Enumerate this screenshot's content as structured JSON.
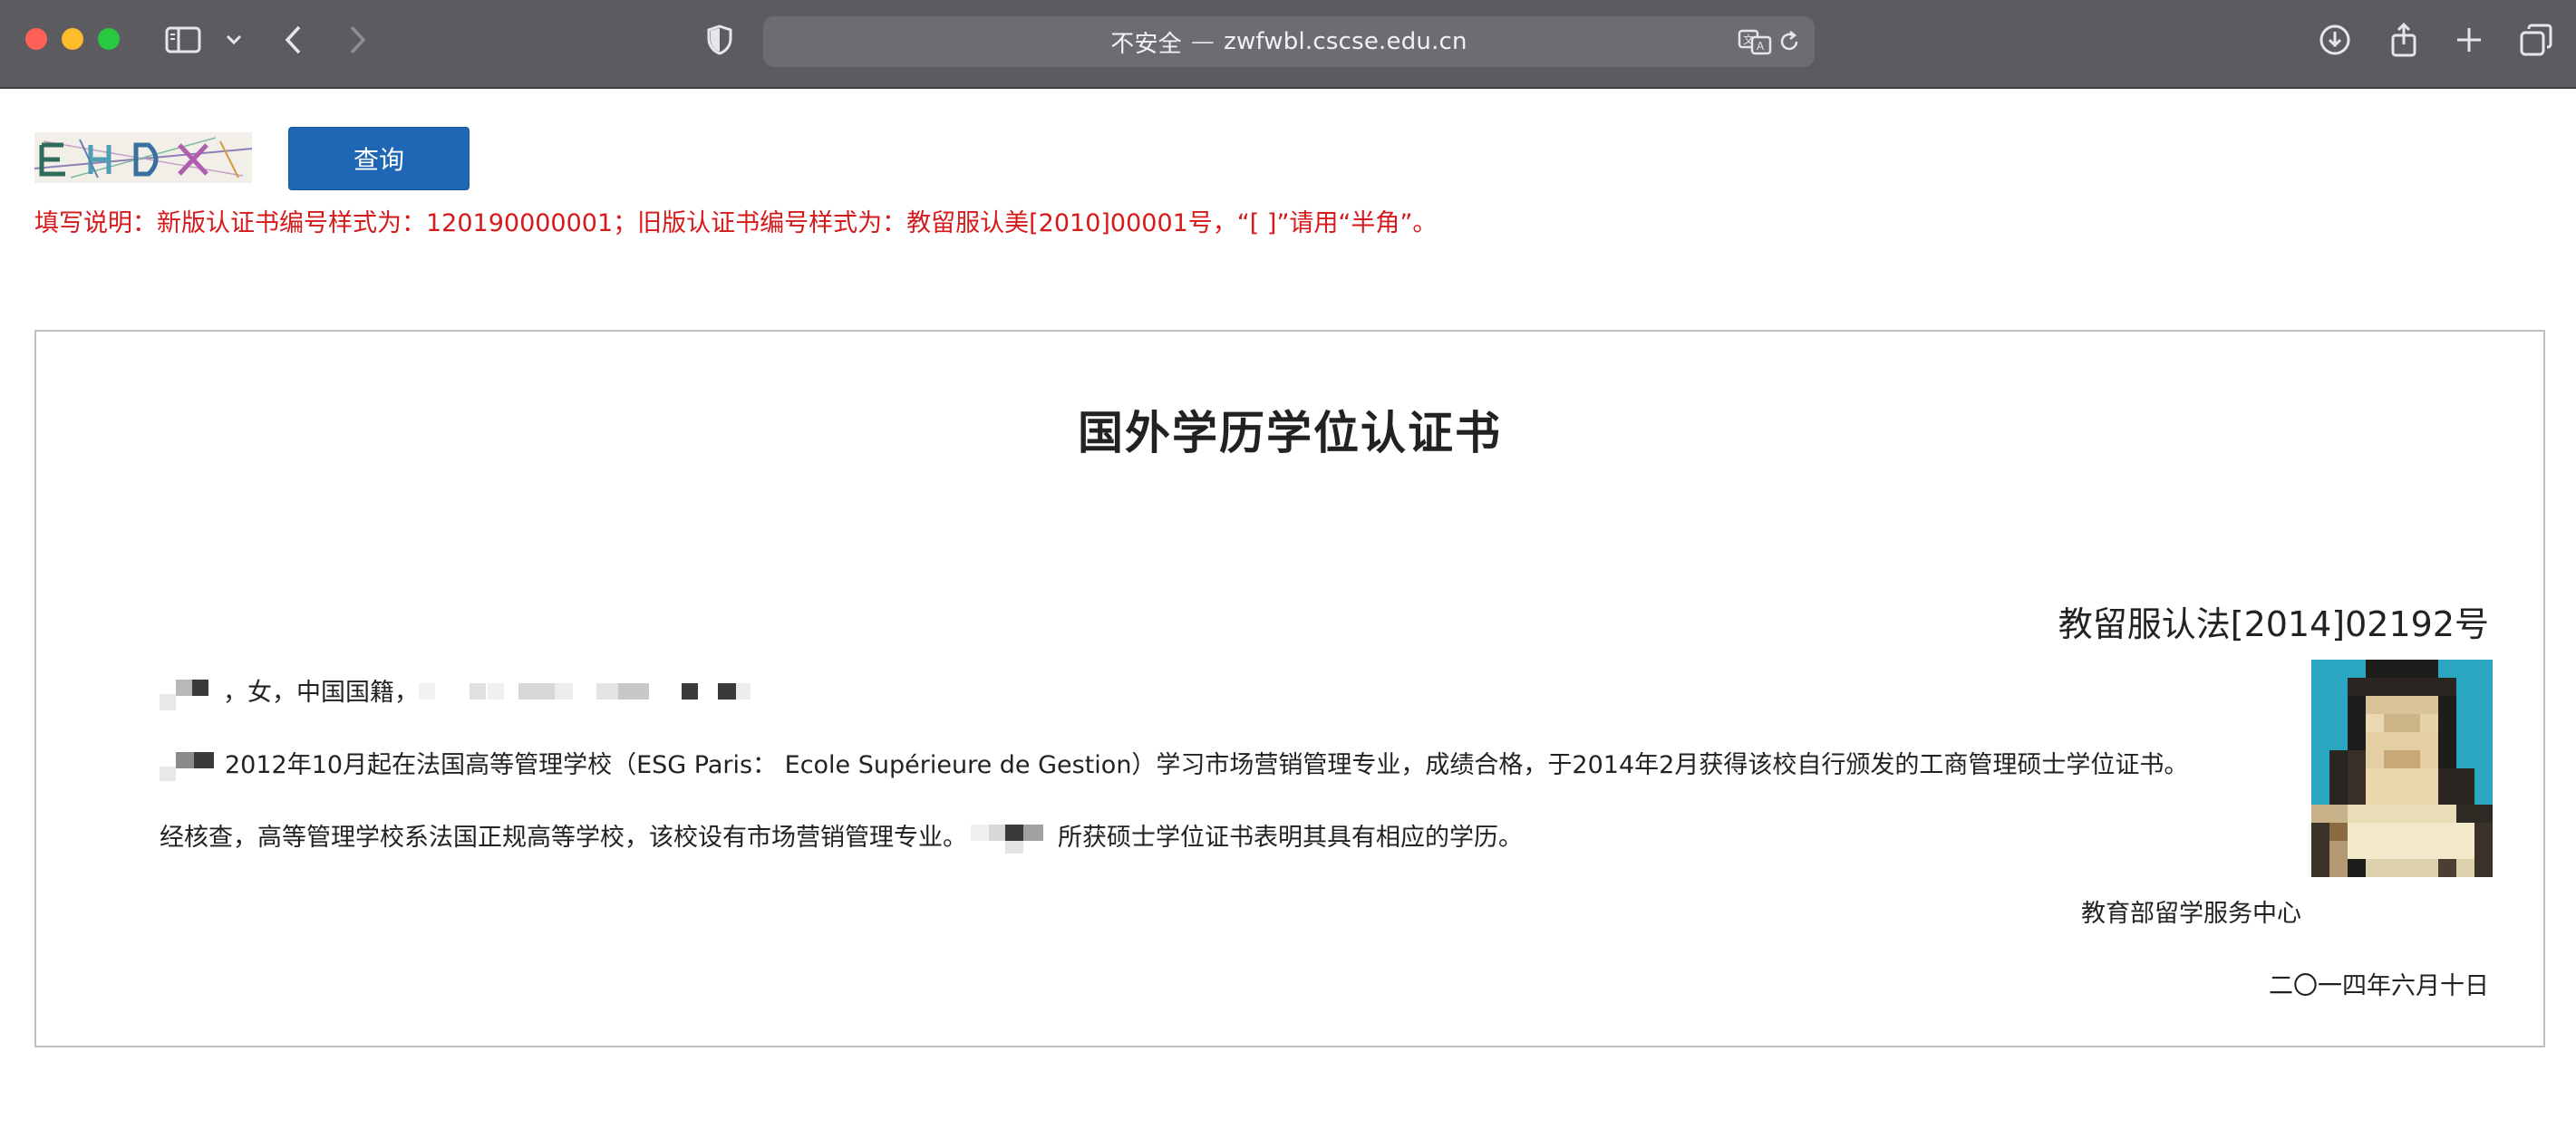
{
  "browser": {
    "url_security": "不安全",
    "url_separator": "—",
    "url_domain": "zwfwbl.cscse.edu.cn"
  },
  "form": {
    "query_button": "查询",
    "instructions": "填写说明：新版认证书编号样式为：120190000001；旧版认证书编号样式为：教留服认美[2010]00001号，“[  ]”请用“半角”。"
  },
  "certificate": {
    "title": "国外学历学位认证书",
    "number": "教留服认法[2014]02192号",
    "line1_suffix": "，女，中国国籍，",
    "line2": "2012年10月起在法国高等管理学校（ESG Paris： Ecole Supérieure de Gestion）学习市场营销管理专业，成绩合格，于2014年2月获得该校自行颁发的工商管理硕士学位证书。",
    "line3_prefix": "经核查，高等管理学校系法国正规高等学校，该校设有市场营销管理专业。",
    "line3_suffix": "所获硕士学位证书表明其具有相应的学历。",
    "issuer": "教育部留学服务中心",
    "date": "二〇一四年六月十日"
  },
  "colors": {
    "toolbar": "#5c5c60",
    "query_button": "#1f66b4",
    "instruction_text": "#d6191b"
  }
}
